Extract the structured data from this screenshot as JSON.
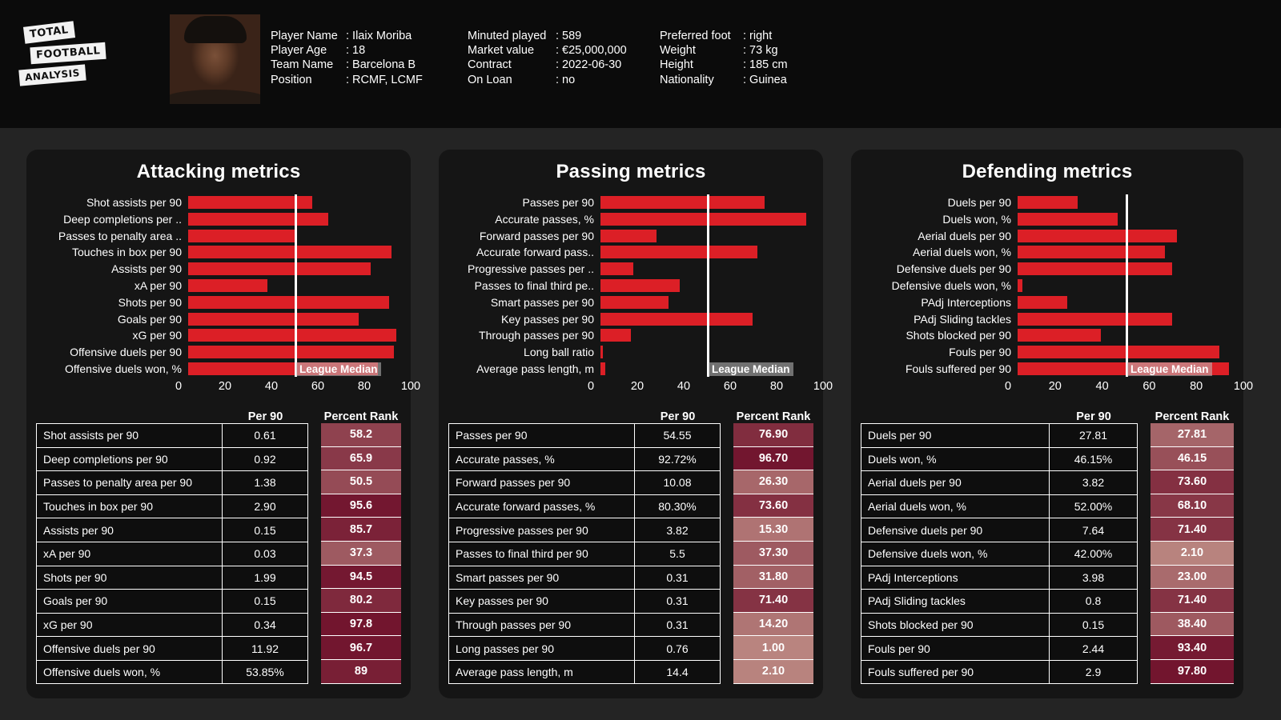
{
  "brand": {
    "line1": "TOTAL",
    "line2": "FOOTBALL",
    "line3": "ANALYSIS"
  },
  "player": {
    "col1": [
      {
        "key": "Player Name",
        "value": ": Ilaix Moriba"
      },
      {
        "key": "Player Age",
        "value": ": 18"
      },
      {
        "key": "Team Name",
        "value": ": Barcelona B"
      },
      {
        "key": "Position",
        "value": ": RCMF, LCMF"
      }
    ],
    "col2": [
      {
        "key": "Minuted played",
        "value": ": 589"
      },
      {
        "key": "Market value",
        "value": ": €25,000,000"
      },
      {
        "key": "Contract",
        "value": ": 2022-06-30"
      },
      {
        "key": "On Loan",
        "value": ": no"
      }
    ],
    "col3": [
      {
        "key": "Preferred foot",
        "value": ": right"
      },
      {
        "key": "Weight",
        "value": ": 73 kg"
      },
      {
        "key": "Height",
        "value": ": 185 cm"
      },
      {
        "key": "Nationality",
        "value": ": Guinea"
      }
    ]
  },
  "table_headers": {
    "per90": "Per 90",
    "rank": "Percent Rank"
  },
  "median_label": "League Median",
  "colors": {
    "bar": "#dc1f26",
    "median_line": "#ffffff",
    "panel_bg": "#151515",
    "page_bg": "#242424"
  },
  "chart_data": [
    {
      "type": "bar",
      "title": "Attacking metrics",
      "xlabel": "",
      "ylabel": "",
      "xlim": [
        0,
        100
      ],
      "ticks": [
        0,
        20,
        40,
        60,
        80,
        100
      ],
      "grid": false,
      "median": 50,
      "median_annotation": "League Median",
      "categories": [
        "Shot assists per 90",
        "Deep completions per ..",
        "Passes to penalty area ..",
        "Touches in box per 90",
        "Assists per 90",
        "xA per 90",
        "Shots per 90",
        "Goals per 90",
        "xG per 90",
        "Offensive duels per 90",
        "Offensive duels won, %"
      ],
      "values": [
        58.2,
        65.9,
        50.5,
        95.6,
        85.7,
        37.3,
        94.5,
        80.2,
        97.8,
        96.7,
        89
      ],
      "table": {
        "columns": [
          "",
          "Per 90",
          "Percent Rank"
        ],
        "rows": [
          {
            "metric": "Shot assists per 90",
            "per90": "0.61",
            "rank": "58.2",
            "rank_value": 58.2
          },
          {
            "metric": "Deep completions per 90",
            "per90": "0.92",
            "rank": "65.9",
            "rank_value": 65.9
          },
          {
            "metric": "Passes to penalty area per 90",
            "per90": "1.38",
            "rank": "50.5",
            "rank_value": 50.5
          },
          {
            "metric": "Touches in box per 90",
            "per90": "2.90",
            "rank": "95.6",
            "rank_value": 95.6
          },
          {
            "metric": "Assists per 90",
            "per90": "0.15",
            "rank": "85.7",
            "rank_value": 85.7
          },
          {
            "metric": "xA per 90",
            "per90": "0.03",
            "rank": "37.3",
            "rank_value": 37.3
          },
          {
            "metric": "Shots per 90",
            "per90": "1.99",
            "rank": "94.5",
            "rank_value": 94.5
          },
          {
            "metric": "Goals per 90",
            "per90": "0.15",
            "rank": "80.2",
            "rank_value": 80.2
          },
          {
            "metric": "xG per 90",
            "per90": "0.34",
            "rank": "97.8",
            "rank_value": 97.8
          },
          {
            "metric": "Offensive duels per 90",
            "per90": "11.92",
            "rank": "96.7",
            "rank_value": 96.7
          },
          {
            "metric": "Offensive duels won, %",
            "per90": "53.85%",
            "rank": "89",
            "rank_value": 89
          }
        ]
      }
    },
    {
      "type": "bar",
      "title": "Passing metrics",
      "xlabel": "",
      "ylabel": "",
      "xlim": [
        0,
        100
      ],
      "ticks": [
        0,
        20,
        40,
        60,
        80,
        100
      ],
      "grid": false,
      "median": 50,
      "median_annotation": "League Median",
      "categories": [
        "Passes per 90",
        "Accurate passes, %",
        "Forward passes per 90",
        "Accurate forward pass..",
        "Progressive passes per ..",
        "Passes to final third pe..",
        "Smart passes per 90",
        "Key passes per 90",
        "Through passes per 90",
        "Long ball ratio",
        "Average pass length, m"
      ],
      "values": [
        76.9,
        96.7,
        26.3,
        73.6,
        15.3,
        37.3,
        31.8,
        71.4,
        14.2,
        1.0,
        2.1
      ],
      "table": {
        "columns": [
          "",
          "Per 90",
          "Percent Rank"
        ],
        "rows": [
          {
            "metric": "Passes per 90",
            "per90": "54.55",
            "rank": "76.90",
            "rank_value": 76.9
          },
          {
            "metric": "Accurate passes, %",
            "per90": "92.72%",
            "rank": "96.70",
            "rank_value": 96.7
          },
          {
            "metric": "Forward passes per 90",
            "per90": "10.08",
            "rank": "26.30",
            "rank_value": 26.3
          },
          {
            "metric": "Accurate forward passes, %",
            "per90": "80.30%",
            "rank": "73.60",
            "rank_value": 73.6
          },
          {
            "metric": "Progressive passes per 90",
            "per90": "3.82",
            "rank": "15.30",
            "rank_value": 15.3
          },
          {
            "metric": "Passes to final third per 90",
            "per90": "5.5",
            "rank": "37.30",
            "rank_value": 37.3
          },
          {
            "metric": "Smart passes per 90",
            "per90": "0.31",
            "rank": "31.80",
            "rank_value": 31.8
          },
          {
            "metric": "Key passes per 90",
            "per90": "0.31",
            "rank": "71.40",
            "rank_value": 71.4
          },
          {
            "metric": "Through passes per 90",
            "per90": "0.31",
            "rank": "14.20",
            "rank_value": 14.2
          },
          {
            "metric": "Long passes per 90",
            "per90": "0.76",
            "rank": "1.00",
            "rank_value": 1.0
          },
          {
            "metric": "Average pass length, m",
            "per90": "14.4",
            "rank": "2.10",
            "rank_value": 2.1
          }
        ]
      }
    },
    {
      "type": "bar",
      "title": "Defending metrics",
      "xlabel": "",
      "ylabel": "",
      "xlim": [
        0,
        100
      ],
      "ticks": [
        0,
        20,
        40,
        60,
        80,
        100
      ],
      "grid": false,
      "median": 50,
      "median_annotation": "League Median",
      "categories": [
        "Duels per 90",
        "Duels won, %",
        "Aerial duels per 90",
        "Aerial duels won, %",
        "Defensive duels per 90",
        "Defensive duels won, %",
        "PAdj Interceptions",
        "PAdj Sliding tackles",
        "Shots blocked per 90",
        "Fouls per 90",
        "Fouls suffered per 90"
      ],
      "values": [
        27.81,
        46.15,
        73.6,
        68.1,
        71.4,
        2.1,
        23.0,
        71.4,
        38.4,
        93.4,
        97.8
      ],
      "table": {
        "columns": [
          "",
          "Per 90",
          "Percent Rank"
        ],
        "rows": [
          {
            "metric": "Duels per 90",
            "per90": "27.81",
            "rank": "27.81",
            "rank_value": 27.81
          },
          {
            "metric": "Duels won, %",
            "per90": "46.15%",
            "rank": "46.15",
            "rank_value": 46.15
          },
          {
            "metric": "Aerial duels per 90",
            "per90": "3.82",
            "rank": "73.60",
            "rank_value": 73.6
          },
          {
            "metric": "Aerial duels won, %",
            "per90": "52.00%",
            "rank": "68.10",
            "rank_value": 68.1
          },
          {
            "metric": "Defensive duels per 90",
            "per90": "7.64",
            "rank": "71.40",
            "rank_value": 71.4
          },
          {
            "metric": "Defensive duels won, %",
            "per90": "42.00%",
            "rank": "2.10",
            "rank_value": 2.1
          },
          {
            "metric": "PAdj Interceptions",
            "per90": "3.98",
            "rank": "23.00",
            "rank_value": 23.0
          },
          {
            "metric": "PAdj Sliding tackles",
            "per90": "0.8",
            "rank": "71.40",
            "rank_value": 71.4
          },
          {
            "metric": "Shots blocked per 90",
            "per90": "0.15",
            "rank": "38.40",
            "rank_value": 38.4
          },
          {
            "metric": "Fouls per 90",
            "per90": "2.44",
            "rank": "93.40",
            "rank_value": 93.4
          },
          {
            "metric": "Fouls suffered per 90",
            "per90": "2.9",
            "rank": "97.80",
            "rank_value": 97.8
          }
        ]
      }
    }
  ]
}
